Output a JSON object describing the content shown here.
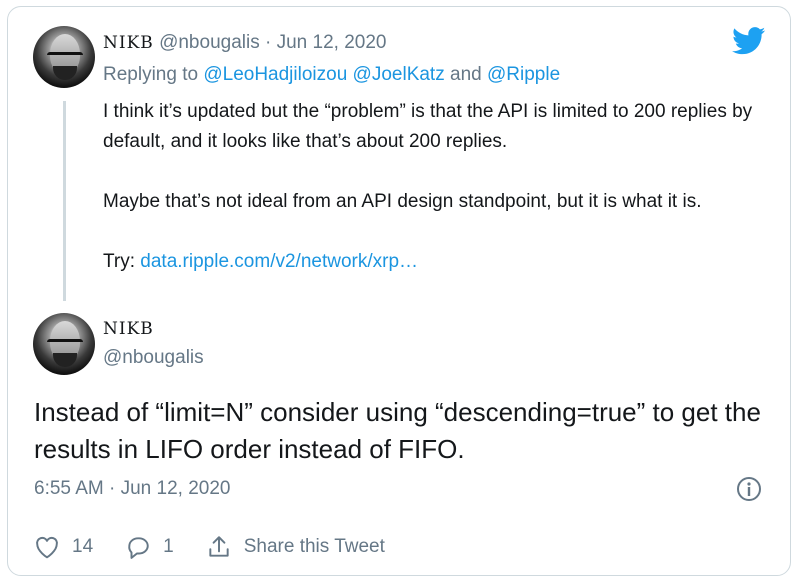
{
  "reply_tweet": {
    "display_name": "NIKB",
    "handle_date": "@nbougalis · Jun 12, 2020",
    "replying_prefix": "Replying to",
    "replying_users": "@LeoHadjiloizou @JoelKatz",
    "replying_and": "and",
    "replying_last": "@Ripple",
    "para1": "I think it’s updated but the “problem” is that the API is limited to 200 replies by default, and it looks like that’s about 200 replies.",
    "para2": "Maybe that’s not ideal from an API design standpoint, but it is what it is.",
    "try_prefix": "Try:",
    "try_link": "data.ripple.com/v2/network/xrp…"
  },
  "main_tweet": {
    "display_name": "NIKB",
    "handle": "@nbougalis",
    "text": "Instead of “limit=N” consider using “descending=true” to get the results in LIFO order instead of FIFO.",
    "timestamp": "6:55 AM · Jun 12, 2020",
    "likes": "14",
    "replies": "1",
    "share_label": "Share this Tweet"
  },
  "icons": {
    "brand": "twitter-bird-icon",
    "info": "info-icon",
    "like": "heart-icon",
    "reply": "reply-bubble-icon",
    "share": "share-icon"
  },
  "colors": {
    "link": "#1b95e0",
    "muted": "#657786",
    "text": "#14171a",
    "border": "#cfd9de"
  }
}
